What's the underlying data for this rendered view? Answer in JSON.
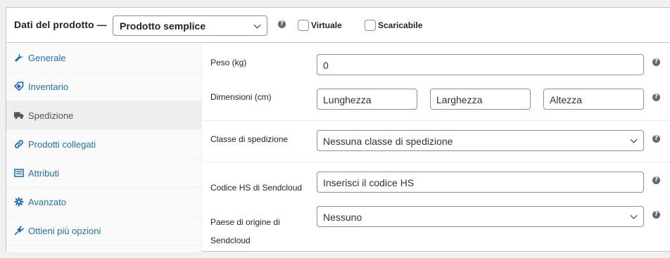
{
  "header": {
    "title": "Dati del prodotto —",
    "product_type": "Prodotto semplice",
    "virtual_label": "Virtuale",
    "downloadable_label": "Scaricabile"
  },
  "sidebar": {
    "items": [
      {
        "label": "Generale",
        "icon": "wrench-icon"
      },
      {
        "label": "Inventario",
        "icon": "tag-icon"
      },
      {
        "label": "Spedizione",
        "icon": "truck-icon"
      },
      {
        "label": "Prodotti collegati",
        "icon": "link-icon"
      },
      {
        "label": "Attributi",
        "icon": "list-icon"
      },
      {
        "label": "Avanzato",
        "icon": "gear-icon"
      },
      {
        "label": "Ottieni più opzioni",
        "icon": "plugin-icon"
      }
    ],
    "active": "Spedizione"
  },
  "shipping": {
    "weight_label": "Peso (kg)",
    "weight_value": "0",
    "dimensions_label": "Dimensioni (cm)",
    "length_placeholder": "Lunghezza",
    "width_placeholder": "Larghezza",
    "height_placeholder": "Altezza",
    "class_label": "Classe di spedizione",
    "class_value": "Nessuna classe di spedizione",
    "hs_label": "Codice HS di Sendcloud",
    "hs_placeholder": "Inserisci il codice HS",
    "origin_label_line1": "Paese di origine di",
    "origin_label_line2": "Sendcloud",
    "origin_value": "Nessuno"
  },
  "colors": {
    "link": "#2271b1",
    "active_tab_bg": "#eeeeee",
    "border": "#c3c4c7"
  }
}
